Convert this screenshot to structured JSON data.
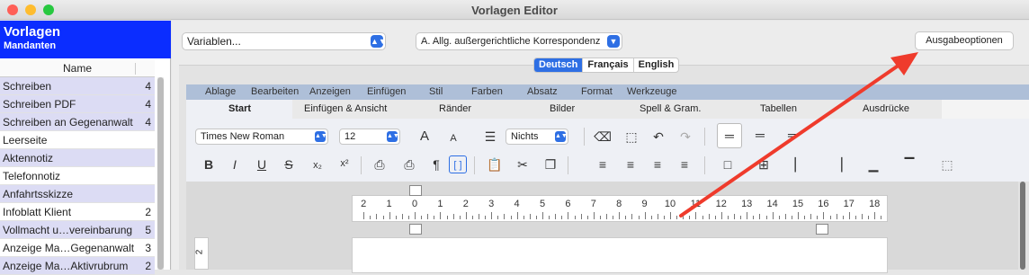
{
  "window": {
    "title": "Vorlagen Editor"
  },
  "colors": {
    "close": "#ff5f57",
    "minimize": "#febc2e",
    "zoom": "#28c840",
    "sidebar_header": "#0b2dff",
    "accent": "#2e6fe4",
    "arrow": "#ef3b2c"
  },
  "sidebar": {
    "title": "Vorlagen",
    "subtitle": "Mandanten",
    "column_header": "Name",
    "items": [
      {
        "label": "Schreiben",
        "count": "4",
        "highlight": true
      },
      {
        "label": "Schreiben PDF",
        "count": "4",
        "highlight": true
      },
      {
        "label": "Schreiben an Gegenanwalt",
        "count": "4",
        "highlight": true
      },
      {
        "label": "Leerseite",
        "count": "",
        "highlight": false
      },
      {
        "label": "Aktennotiz",
        "count": "",
        "highlight": true
      },
      {
        "label": "Telefonnotiz",
        "count": "",
        "highlight": false
      },
      {
        "label": "Anfahrtsskizze",
        "count": "",
        "highlight": true
      },
      {
        "label": "Infoblatt Klient",
        "count": "2",
        "highlight": false
      },
      {
        "label": "Vollmacht u…vereinbarung",
        "count": "5",
        "highlight": true
      },
      {
        "label": "Anzeige Ma…Gegenanwalt",
        "count": "3",
        "highlight": false
      },
      {
        "label": "Anzeige Ma…Aktivrubrum",
        "count": "2",
        "highlight": true
      }
    ]
  },
  "top": {
    "variables_select": "Variablen...",
    "template_select": "A. Allg. außergerichtliche Korrespondenz",
    "output_button": "Ausgabeoptionen"
  },
  "languages": [
    {
      "label": "Deutsch",
      "selected": true
    },
    {
      "label": "Français",
      "selected": false
    },
    {
      "label": "English",
      "selected": false
    }
  ],
  "menu": [
    "Ablage",
    "Bearbeiten",
    "Anzeigen",
    "Einfügen",
    "Stil",
    "Farben",
    "Absatz",
    "Format",
    "Werkzeuge"
  ],
  "ribbon_tabs": [
    "Start",
    "Einfügen & Ansicht",
    "Ränder",
    "Bilder",
    "Spell & Gram.",
    "Tabellen",
    "Ausdrücke"
  ],
  "ribbon_active": "Start",
  "format": {
    "font": "Times New Roman",
    "size": "12",
    "list_style": "Nichts"
  },
  "toolbar_icons": {
    "grow_font": "A",
    "shrink_font": "A",
    "bold": "B",
    "italic": "I",
    "underline": "U",
    "strike": "S",
    "subscript": "x₂",
    "superscript": "x²",
    "pilcrow": "¶",
    "brackets": "[ ]",
    "undo": "↶",
    "redo": "↷",
    "cut": "✂"
  },
  "ruler": {
    "labels": [
      "2",
      "1",
      "0",
      "1",
      "2",
      "3",
      "4",
      "5",
      "6",
      "7",
      "8",
      "9",
      "10",
      "11",
      "12",
      "13",
      "14",
      "15",
      "16",
      "17",
      "18"
    ]
  },
  "vertical_ruler": {
    "label": "2"
  }
}
